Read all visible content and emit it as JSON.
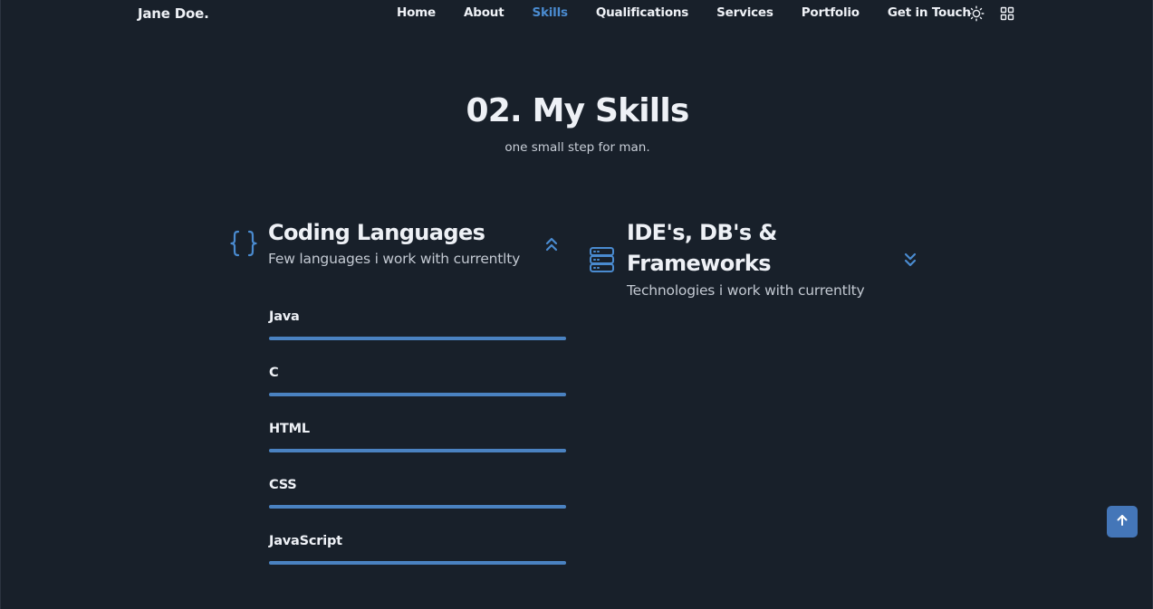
{
  "header": {
    "logo": "Jane Doe.",
    "nav": [
      "Home",
      "About",
      "Skills",
      "Qualifications",
      "Services",
      "Portfolio",
      "Get in Touch"
    ],
    "active_nav": "Skills"
  },
  "section": {
    "title": "02. My Skills",
    "subtitle": "one small step for man."
  },
  "groups": [
    {
      "title": "Coding Languages",
      "subtitle": "Few languages i work with currentlty",
      "state": "expanded",
      "skills": [
        {
          "name": "Java",
          "level": 1.0
        },
        {
          "name": "C",
          "level": 1.0
        },
        {
          "name": "HTML",
          "level": 1.0
        },
        {
          "name": "CSS",
          "level": 1.0
        },
        {
          "name": "JavaScript",
          "level": 1.0
        }
      ]
    },
    {
      "title_line1": "IDE's, DB's &",
      "title_line2": "Frameworks",
      "subtitle": "Technologies i work with currentlty",
      "state": "collapsed"
    }
  ],
  "colors": {
    "background": "#18202a",
    "accent": "#4a8bd0",
    "bar": "#4a82c1",
    "button": "#4476b8",
    "text": "#eef1f6"
  },
  "icons": {
    "theme": "sun-icon",
    "menu": "grid-icon",
    "group1": "code-braces-icon",
    "group2": "server-icon",
    "scroll": "arrow-up-icon"
  }
}
